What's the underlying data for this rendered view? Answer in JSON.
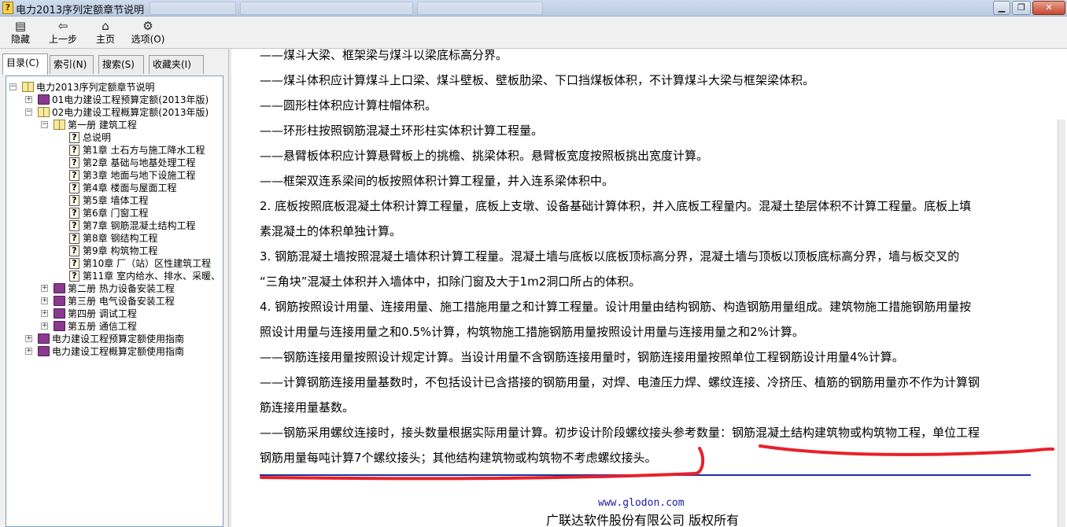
{
  "window": {
    "title": "电力2013序列定额章节说明"
  },
  "toolbar": {
    "hide": "隐藏",
    "back": "上一步",
    "home": "主页",
    "options": "选项(O)"
  },
  "tabs": {
    "contents": "目录(C)",
    "index": "索引(N)",
    "search": "搜索(S)",
    "favorites": "收藏夹(I)"
  },
  "tree": {
    "root": "电力2013序列定额章节说明",
    "n01": "01电力建设工程预算定额(2013年版)",
    "n02": "02电力建设工程概算定额(2013年版)",
    "vol1": "第一册 建筑工程",
    "general": "总说明",
    "ch1": "第1章 土石方与施工降水工程",
    "ch2": "第2章 基础与地基处理工程",
    "ch3": "第3章 地面与地下设施工程",
    "ch4": "第4章 楼面与屋面工程",
    "ch5": "第5章 墙体工程",
    "ch6": "第6章 门窗工程",
    "ch7": "第7章 钢筋混凝土结构工程",
    "ch8": "第8章 钢结构工程",
    "ch9": "第9章 构筑物工程",
    "ch10": "第10章 厂（站）区性建筑工程",
    "ch11": "第11章 室内给水、排水、采暖、",
    "vol2": "第二册 热力设备安装工程",
    "vol3": "第三册 电气设备安装工程",
    "vol4": "第四册 调试工程",
    "vol5": "第五册 通信工程",
    "guide1": "电力建设工程预算定额使用指南",
    "guide2": "电力建设工程概算定额使用指南"
  },
  "content": {
    "p0": "——煤斗大梁、框架梁与煤斗以梁底标高分界。",
    "p1": "——煤斗体积应计算煤斗上口梁、煤斗壁板、壁板肋梁、下口挡煤板体积，不计算煤斗大梁与框架梁体积。",
    "p2": "——圆形柱体积应计算柱帽体积。",
    "p3": "——环形柱按照钢筋混凝土环形柱实体积计算工程量。",
    "p4": "——悬臂板体积应计算悬臂板上的挑檐、挑梁体积。悬臂板宽度按照板挑出宽度计算。",
    "p5": "——框架双连系梁间的板按照体积计算工程量，并入连系梁体积中。",
    "p6a": "2. 底板按照底板混凝土体积计算工程量，底板上支墩、设备基础计算体积，并入底板工程量内。混凝土垫层体积不计算工程量。底板上填",
    "p6b": "素混凝土的体积单独计算。",
    "p7a": "3. 钢筋混凝土墙按照混凝土墙体积计算工程量。混凝土墙与底板以底板顶标高分界，混凝土墙与顶板以顶板底标高分界，墙与板交叉的",
    "p7b": "“三角块”混凝土体积并入墙体中，扣除门窗及大于1m2洞口所占的体积。",
    "p8a": "4. 钢筋按照设计用量、连接用量、施工措施用量之和计算工程量。设计用量由结构钢筋、构造钢筋用量组成。建筑物施工措施钢筋用量按",
    "p8b": "照设计用量与连接用量之和0.5%计算，构筑物施工措施钢筋用量按照设计用量与连接用量之和2%计算。",
    "p9": "——钢筋连接用量按照设计规定计算。当设计用量不含钢筋连接用量时，钢筋连接用量按照单位工程钢筋设计用量4%计算。",
    "p10a": "——计算钢筋连接用量基数时，不包括设计已含搭接的钢筋用量，对焊、电渣压力焊、螺纹连接、冷挤压、植筋的钢筋用量亦不作为计算钢",
    "p10b": "筋连接用量基数。",
    "p11a": "——钢筋采用螺纹连接时，接头数量根据实际用量计算。初步设计阶段螺纹接头参考数量：钢筋混凝土结构建筑物或构筑物工程，单位工程",
    "p11b": "钢筋用量每吨计算7个螺纹接头；其他结构建筑物或构筑物不考虑螺纹接头。",
    "footer_link": "www.glodon.com",
    "footer_copy": "广联达软件股份有限公司 版权所有"
  },
  "colors": {
    "annotation": "#e8202a",
    "rule": "#2030a0",
    "link": "#1a1aa6"
  }
}
